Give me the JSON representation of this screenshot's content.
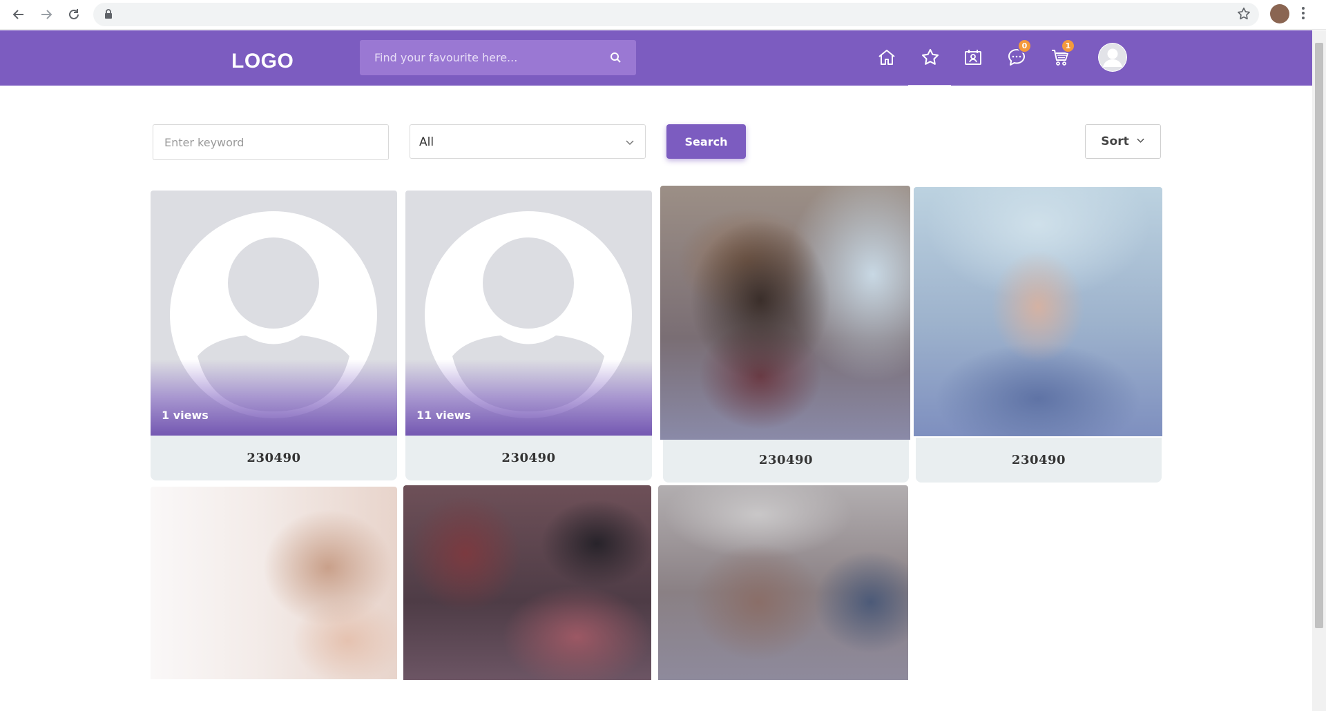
{
  "browser": {
    "url": ""
  },
  "header": {
    "logo": "LOGO",
    "search_placeholder": "Find your favourite here...",
    "nav_icons": [
      "home-icon",
      "star-icon",
      "contacts-icon",
      "chat-icon",
      "cart-icon"
    ],
    "chat_badge": "0",
    "cart_badge": "1",
    "active_nav": "star-icon"
  },
  "filters": {
    "keyword_placeholder": "Enter keyword",
    "category_selected": "All",
    "search_label": "Search",
    "sort_label": "Sort"
  },
  "cards": [
    {
      "name": "230490",
      "views": "1 views",
      "image": "default-avatar"
    },
    {
      "name": "230490",
      "views": "11 views",
      "image": "default-avatar"
    },
    {
      "name": "230490",
      "views": "",
      "image": "blurred-photo"
    },
    {
      "name": "230490",
      "views": "",
      "image": "blurred-photo"
    },
    {
      "name": "",
      "views": "",
      "image": "blurred-photo"
    },
    {
      "name": "",
      "views": "",
      "image": "blurred-photo"
    },
    {
      "name": "",
      "views": "",
      "image": "blurred-photo"
    }
  ],
  "colors": {
    "brand": "#7c5cc0",
    "badge": "#f49a3c",
    "caption_bg": "#e9eef0"
  }
}
